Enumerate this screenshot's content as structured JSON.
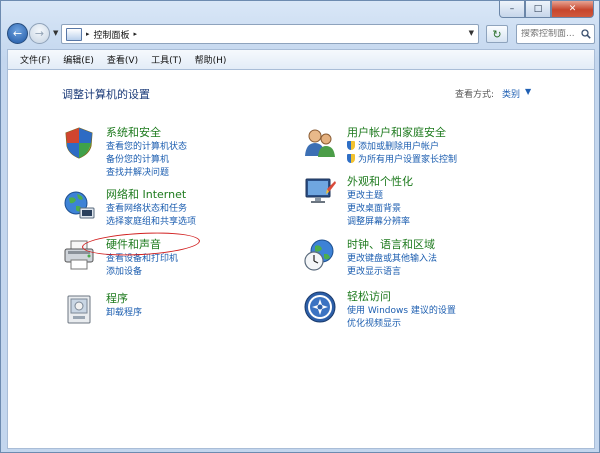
{
  "window": {
    "caption": {
      "minimize": "–",
      "maximize": "□",
      "close": "✕"
    }
  },
  "navigation": {
    "back_icon": "←",
    "forward_icon": "→",
    "dropdown_icon": "▼"
  },
  "address_bar": {
    "separator": "▸",
    "crumb": "控制面板",
    "trailing_separator": "▸",
    "dropdown_icon": "▼"
  },
  "refresh_icon": "↻",
  "search": {
    "placeholder": "搜索控制面..."
  },
  "menu": {
    "items": [
      "文件(F)",
      "编辑(E)",
      "查看(V)",
      "工具(T)",
      "帮助(H)"
    ]
  },
  "content": {
    "page_title": "调整计算机的设置",
    "view_by_label": "查看方式:",
    "view_by_value": "类别",
    "view_by_arrow": "▼",
    "categories": [
      {
        "title": "系统和安全",
        "links": [
          "查看您的计算机状态",
          "备份您的计算机",
          "查找并解决问题"
        ]
      },
      {
        "title": "网络和 Internet",
        "links": [
          "查看网络状态和任务",
          "选择家庭组和共享选项"
        ]
      },
      {
        "title": "硬件和声音",
        "links": [
          "查看设备和打印机",
          "添加设备"
        ]
      },
      {
        "title": "程序",
        "links": [
          "卸载程序"
        ]
      },
      {
        "title": "用户帐户和家庭安全",
        "links": [
          "添加或删除用户帐户",
          "为所有用户设置家长控制"
        ]
      },
      {
        "title": "外观和个性化",
        "links": [
          "更改主题",
          "更改桌面背景",
          "调整屏幕分辨率"
        ]
      },
      {
        "title": "时钟、语言和区域",
        "links": [
          "更改键盘或其他输入法",
          "更改显示语言"
        ]
      },
      {
        "title": "轻松访问",
        "links": [
          "使用 Windows 建议的设置",
          "优化视频显示"
        ]
      }
    ]
  },
  "colors": {
    "category_title": "#1d7a1d",
    "link": "#1c5eb0",
    "page_title": "#1a3a78",
    "annotation_circle": "#d11f1f"
  }
}
